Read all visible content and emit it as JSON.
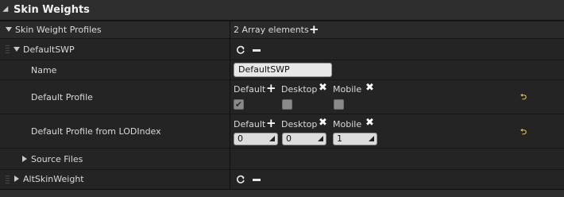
{
  "header": {
    "title": "Skin Weights"
  },
  "profiles_row": {
    "label": "Skin Weight Profiles",
    "value": "2 Array elements"
  },
  "element0": {
    "label": "DefaultSWP",
    "name_label": "Name",
    "name_value": "DefaultSWP",
    "default_profile_label": "Default Profile",
    "default_profile_lod_label": "Default Profile from LODIndex",
    "platforms": [
      "Default",
      "Desktop",
      "Mobile"
    ],
    "checks": [
      true,
      false,
      false
    ],
    "lod_values": [
      "0",
      "0",
      "1"
    ],
    "source_files_label": "Source Files"
  },
  "element1": {
    "label": "AltSkinWeight"
  },
  "colors": {
    "bg": "#161616",
    "panel": "#242424",
    "revert": "#e1c54a"
  }
}
